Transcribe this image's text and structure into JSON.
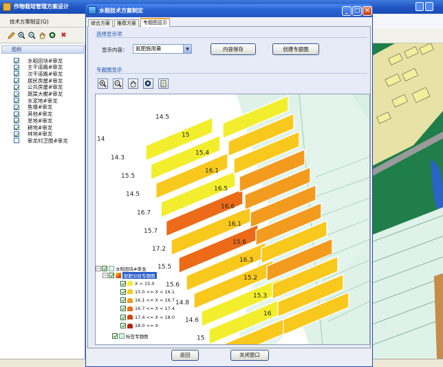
{
  "bg_app": {
    "title": "作物栽培管理方案设计",
    "menu_item": "技术方案制定(Q)",
    "legend_header": "图例",
    "legend_items": [
      {
        "label": "水稻田块#审龙",
        "checked": true
      },
      {
        "label": "主干道路#审龙",
        "checked": true
      },
      {
        "label": "次干道路#审龙",
        "checked": true
      },
      {
        "label": "居民房屋#审龙",
        "checked": true
      },
      {
        "label": "公共房屋#审龙",
        "checked": true
      },
      {
        "label": "蔬菜大棚#审龙",
        "checked": true
      },
      {
        "label": "水泥地#审龙",
        "checked": true
      },
      {
        "label": "鱼塘#审龙",
        "checked": true
      },
      {
        "label": "其他#审龙",
        "checked": true
      },
      {
        "label": "旱地#审龙",
        "checked": true
      },
      {
        "label": "耕地#审龙",
        "checked": true
      },
      {
        "label": "林地#审龙",
        "checked": true
      },
      {
        "label": "审龙村卫图#审龙",
        "checked": false
      }
    ]
  },
  "dialog": {
    "title": "水稻技术方案制定",
    "tabs": [
      "综合方案",
      "推荐方案",
      "专题图显示"
    ],
    "active_tab": 2,
    "section_select": "选择显示项",
    "display_label": "显示内容：",
    "display_value": "氮肥施用量",
    "save_button": "内容保存",
    "create_button": "创建专题图",
    "section_map": "专题图显示",
    "back_button": "返回",
    "close_button": "关闭窗口"
  },
  "map": {
    "field_values": [
      "14",
      "14.3",
      "15.5",
      "14.5",
      "16.7",
      "15.7",
      "17.2",
      "15.5",
      "15.6",
      "14.8",
      "14.6",
      "15",
      "14.5",
      "15",
      "15.4",
      "16.1",
      "16.5",
      "16.6",
      "16.1",
      "15.6",
      "16.3",
      "15.2",
      "15.3",
      "16"
    ],
    "colors": {
      "lt15": "#f2ee2e",
      "c15_161": "#f8c81c",
      "c161_167": "#f39b1f",
      "c167_174": "#ec6a18",
      "c174_18": "#d94012",
      "ge18": "#b8230e"
    }
  },
  "tree": {
    "root": "水稻田块#审龙",
    "layer": "配肥分段专题图",
    "classes": [
      "X < 15.0",
      "15.0 <= X < 16.1",
      "16.1 <= X < 16.7",
      "16.7 <= X < 17.4",
      "17.4 <= X < 18.0",
      "18.0 <= X"
    ],
    "base": "标签专题图"
  }
}
